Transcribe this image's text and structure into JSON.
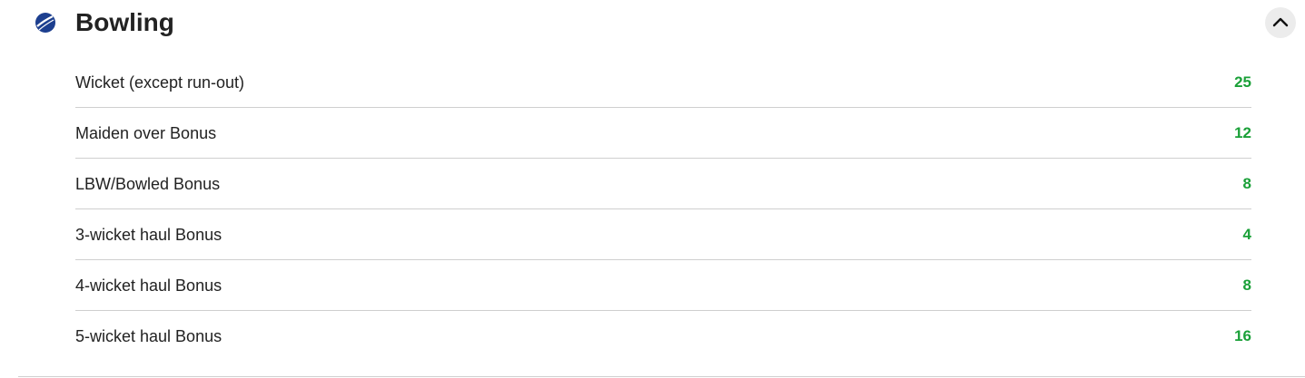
{
  "section": {
    "title": "Bowling",
    "icon": "cricket-ball-icon",
    "collapse_icon": "chevron-up-icon",
    "colors": {
      "value": "#1aa038",
      "icon": "#1d3f8f",
      "text": "#222222"
    }
  },
  "rows": [
    {
      "label": "Wicket (except run-out)",
      "value": "25"
    },
    {
      "label": "Maiden over Bonus",
      "value": "12"
    },
    {
      "label": "LBW/Bowled Bonus",
      "value": "8"
    },
    {
      "label": "3-wicket haul Bonus",
      "value": "4"
    },
    {
      "label": "4-wicket haul Bonus",
      "value": "8"
    },
    {
      "label": "5-wicket haul Bonus",
      "value": "16"
    }
  ]
}
